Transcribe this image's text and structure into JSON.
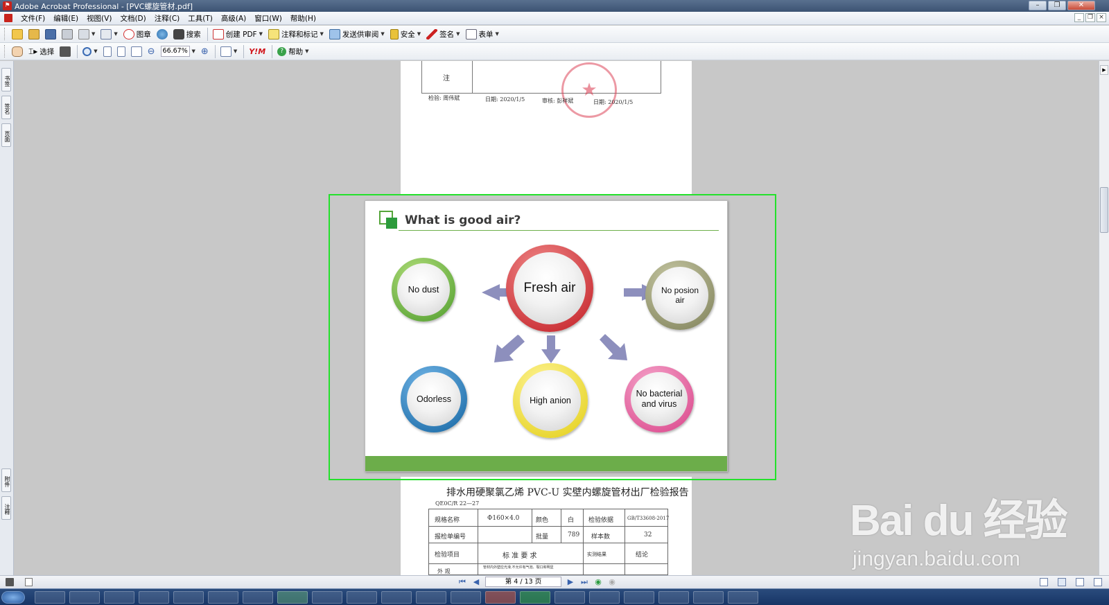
{
  "window": {
    "title": "Adobe Acrobat Professional - [PVC螺旋管材.pdf]"
  },
  "menu": [
    "文件(F)",
    "编辑(E)",
    "视图(V)",
    "文档(D)",
    "注释(C)",
    "工具(T)",
    "高级(A)",
    "窗口(W)",
    "帮助(H)"
  ],
  "toolbar1": {
    "stamp": "图章",
    "search": "搜索",
    "create_pdf": "创建 PDF",
    "comment": "注释和标记",
    "send_review": "发送供审阅",
    "security": "安全",
    "sign": "签名",
    "forms": "表单"
  },
  "toolbar2": {
    "select": "选择",
    "zoom": "66.67%",
    "help": "帮助"
  },
  "left_tabs": [
    "书签",
    "签名",
    "页面",
    "附件",
    "注释"
  ],
  "page_top": {
    "note_label": "注",
    "inspector": "检验: 周伟斌",
    "date1": "日期: 2020/1/5",
    "reviewer": "审核: 彭祥斌",
    "date2": "日期: 2020/1/5"
  },
  "slide": {
    "title": "What is good air?",
    "center": "Fresh air",
    "left": "No dust",
    "right": "No posion air",
    "bottom_left": "Odorless",
    "bottom_center": "High anion",
    "bottom_right": "No bacterial and virus",
    "colors": {
      "green": "#6cad4a",
      "red": "#d3222a",
      "olive": "#8f9268",
      "blue": "#1a7cc1",
      "yellow": "#f1e41d",
      "pink": "#e85a9c",
      "arrow": "#8d8fbd"
    }
  },
  "page_bottom": {
    "heading": "排水用硬聚氯乙烯 PVC-U 实壁内螺旋管材出厂检验报告",
    "code": "QE0C/R 22—27",
    "row1": [
      "规格名称",
      "Φ160×4.0",
      "颜色",
      "白",
      "检验依据",
      "GB/T33608-2017"
    ],
    "row2": [
      "报检单编号",
      "",
      "批量",
      "789",
      "样本数",
      "32"
    ],
    "row3": [
      "检验项目",
      "标 准 要 求",
      "实测结果",
      "结论"
    ],
    "row4": [
      "外 观",
      "管材内外壁应光滑,不允许有气泡、裂口和明显"
    ]
  },
  "status": {
    "page": "第 4 / 13 页"
  },
  "watermark": {
    "brand": "Bai du 经验",
    "url": "jingyan.baidu.com"
  }
}
